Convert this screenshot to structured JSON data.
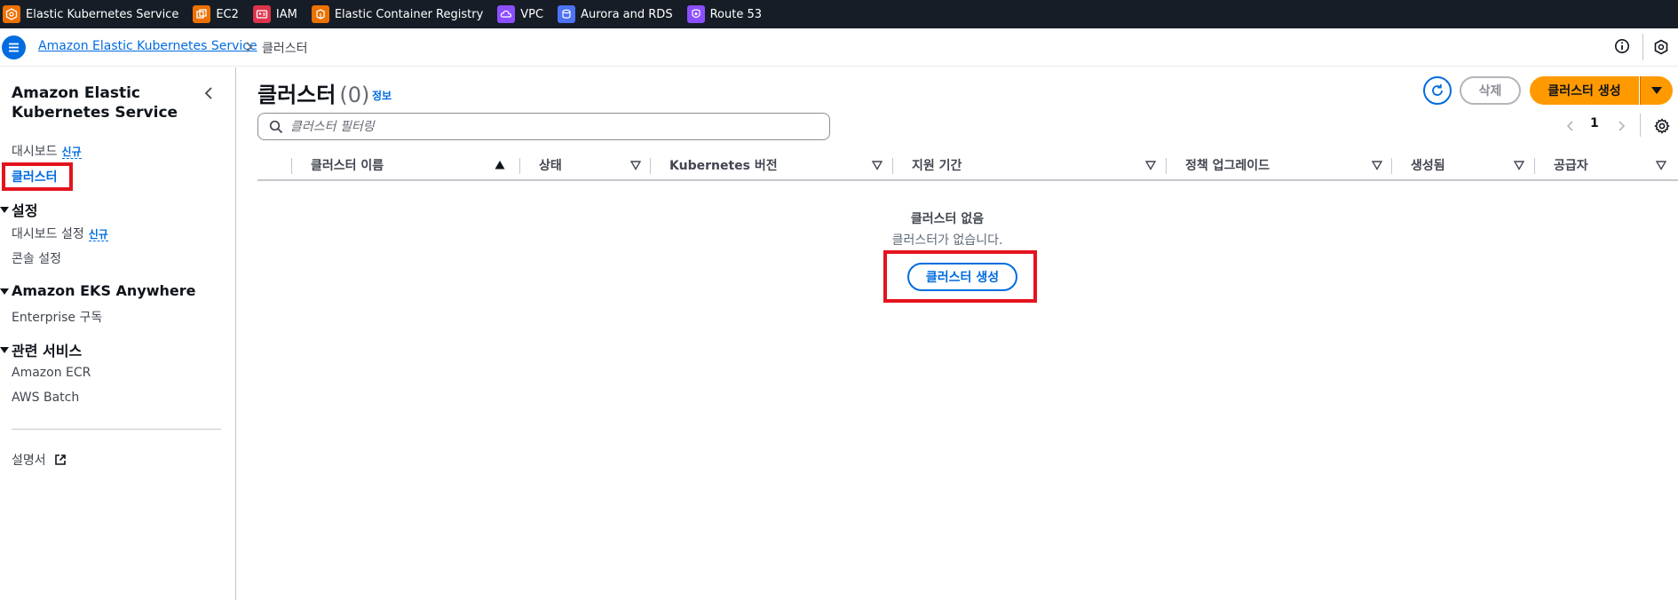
{
  "favorites": [
    {
      "label": "Elastic Kubernetes Service",
      "color": "#ed7100",
      "icon": "eks-icon"
    },
    {
      "label": "EC2",
      "color": "#ed7100",
      "icon": "ec2-icon"
    },
    {
      "label": "IAM",
      "color": "#dd344c",
      "icon": "iam-icon"
    },
    {
      "label": "Elastic Container Registry",
      "color": "#ed7100",
      "icon": "ecr-icon"
    },
    {
      "label": "VPC",
      "color": "#8c4fff",
      "icon": "vpc-icon"
    },
    {
      "label": "Aurora and RDS",
      "color": "#4d72f3",
      "icon": "rds-icon"
    },
    {
      "label": "Route 53",
      "color": "#8c4fff",
      "icon": "route53-icon"
    }
  ],
  "breadcrumb": {
    "root": "Amazon Elastic Kubernetes Service",
    "current": "클러스터"
  },
  "sidenav": {
    "title": "Amazon Elastic Kubernetes Service",
    "dashboard": "대시보드",
    "new_badge": "신규",
    "clusters": "클러스터",
    "settings_section": "설정",
    "dashboard_settings": "대시보드 설정",
    "console_settings": "콘솔 설정",
    "eks_anywhere_section": "Amazon EKS Anywhere",
    "enterprise": "Enterprise 구독",
    "related_section": "관련 서비스",
    "ecr": "Amazon ECR",
    "batch": "AWS Batch",
    "docs": "설명서"
  },
  "main": {
    "title": "클러스터",
    "count": "(0)",
    "info": "정보",
    "delete_label": "삭제",
    "create_label": "클러스터 생성",
    "filter_placeholder": "클러스터 필터링",
    "page": "1",
    "columns": [
      "클러스터 이름",
      "상태",
      "Kubernetes 버전",
      "지원 기간",
      "정책 업그레이드",
      "생성됨",
      "공급자"
    ],
    "empty_title": "클러스터 없음",
    "empty_text": "클러스터가 없습니다.",
    "empty_create_label": "클러스터 생성"
  },
  "colors": {
    "accent": "#006ce0",
    "primary_button": "#ff9900",
    "highlight": "#e3141e",
    "topbar": "#161d26"
  }
}
